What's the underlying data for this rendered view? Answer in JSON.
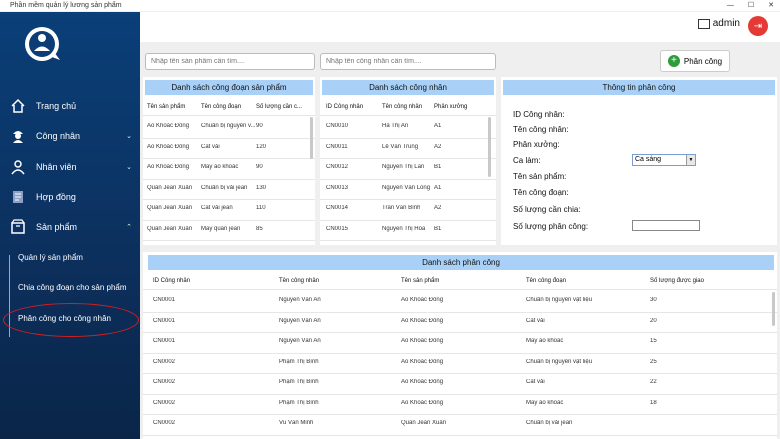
{
  "window": {
    "title": "Phần mềm quản lý lương sản phẩm",
    "controls": [
      "—",
      "☐",
      "✕"
    ]
  },
  "sidebar": {
    "items": [
      {
        "label": "Trang chủ",
        "icon": "home-icon"
      },
      {
        "label": "Công nhân",
        "icon": "worker-icon",
        "chevron": "⌄"
      },
      {
        "label": "Nhân viên",
        "icon": "person-icon",
        "chevron": "⌄"
      },
      {
        "label": "Hợp đồng",
        "icon": "contract-icon"
      },
      {
        "label": "Sản phẩm",
        "icon": "box-icon",
        "chevron": "⌃"
      }
    ],
    "sub_items": [
      "Quản lý sản phẩm",
      "Chia công đoạn cho sản phẩm",
      "Phân công cho công nhân"
    ]
  },
  "header": {
    "user": "admin"
  },
  "search": {
    "product_placeholder": "Nhập tên sản phẩm cần tìm....",
    "worker_placeholder": "Nhập tên công nhân cần tìm...."
  },
  "assign_button": {
    "label": "Phân công"
  },
  "stages_panel": {
    "title": "Danh sách công đoạn sản phẩm",
    "headers": [
      "Tên sản phẩm",
      "Tên công đoạn",
      "Số lượng cần c..."
    ],
    "rows": [
      [
        "Áo Khoác Đông",
        "Chuẩn bị nguyên v...",
        "90"
      ],
      [
        "Áo Khoác Đông",
        "Cắt vải",
        "120"
      ],
      [
        "Áo Khoác Đông",
        "May áo khoác",
        "90"
      ],
      [
        "Quần Jean Xuân",
        "Chuẩn bị vải jean",
        "130"
      ],
      [
        "Quần Jean Xuân",
        "Cắt vải jean",
        "110"
      ],
      [
        "Quần Jean Xuân",
        "May quần jean",
        "85"
      ]
    ]
  },
  "workers_panel": {
    "title": "Danh sách công nhân",
    "headers": [
      "ID Công nhân",
      "Tên công nhân",
      "Phân xưởng"
    ],
    "rows": [
      [
        "CN0010",
        "Hà Thị An",
        "A1"
      ],
      [
        "CN0011",
        "Lê Văn Trung",
        "A2"
      ],
      [
        "CN0012",
        "Nguyễn Thị Lan",
        "B1"
      ],
      [
        "CN0013",
        "Nguyễn Văn Long",
        "A1"
      ],
      [
        "CN0014",
        "Trần Văn Bình",
        "A2"
      ],
      [
        "CN0015",
        "Nguyễn Thị Hoa",
        "B1"
      ]
    ]
  },
  "info_panel": {
    "title": "Thông tin phân công",
    "labels": [
      "ID Công nhân:",
      "Tên công nhân:",
      "Phân xưởng:",
      "Ca làm:",
      "Tên sản phẩm:",
      "Tên công đoạn:",
      "Số lượng cần chia:",
      "Số lượng phân công:"
    ],
    "shift_value": "Ca sáng"
  },
  "assignments_panel": {
    "title": "Danh sách phân công",
    "headers": [
      "ID Công nhân",
      "Tên công nhân",
      "Tên sản phẩm",
      "Tên công đoạn",
      "Số lượng được giao"
    ],
    "rows": [
      [
        "CN0001",
        "Nguyễn Văn An",
        "Áo Khoác Đông",
        "Chuẩn bị nguyên vật liệu",
        "30"
      ],
      [
        "CN0001",
        "Nguyễn Văn An",
        "Áo Khoác Đông",
        "Cắt vải",
        "20"
      ],
      [
        "CN0001",
        "Nguyễn Văn An",
        "Áo Khoác Đông",
        "May áo khoác",
        "15"
      ],
      [
        "CN0002",
        "Phạm Thị Bình",
        "Áo Khoác Đông",
        "Chuẩn bị nguyên vật liệu",
        "25"
      ],
      [
        "CN0002",
        "Phạm Thị Bình",
        "Áo Khoác Đông",
        "Cắt vải",
        "22"
      ],
      [
        "CN0002",
        "Phạm Thị Bình",
        "Áo Khoác Đông",
        "May áo khoác",
        "18"
      ],
      [
        "CN0002",
        "Vũ Văn Minh",
        "Quần Jean Xuân",
        "Chuẩn bị vải jean",
        ""
      ]
    ]
  }
}
